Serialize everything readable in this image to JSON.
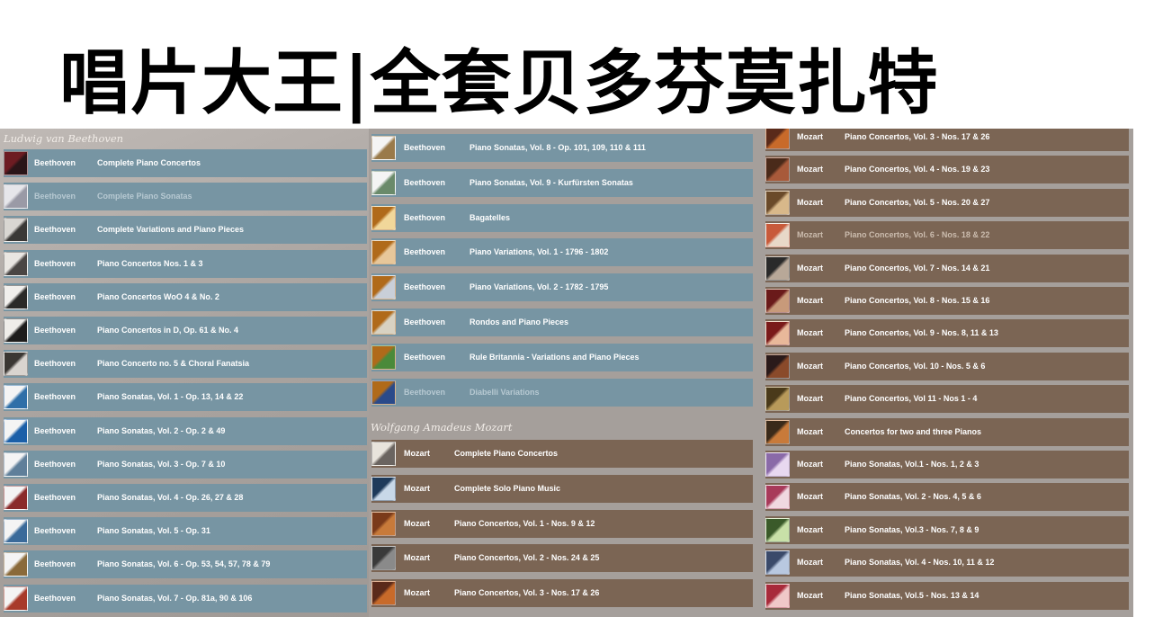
{
  "banner": {
    "title": "唱片大王|全套贝多芬莫扎特"
  },
  "columns": {
    "left": {
      "section_title": "Ludwig van Beethoven",
      "items": [
        {
          "composer": "Beethoven",
          "title": "Complete Piano Concertos",
          "thumb": [
            "#6d1c22",
            "#2a1518"
          ],
          "dim": false
        },
        {
          "composer": "Beethoven",
          "title": "Complete Piano Sonatas",
          "thumb": [
            "#e6e6ea",
            "#9a9aa6"
          ],
          "dim": true
        },
        {
          "composer": "Beethoven",
          "title": "Complete Variations and Piano Pieces",
          "thumb": [
            "#d9d6d2",
            "#3a3836"
          ],
          "dim": false
        },
        {
          "composer": "Beethoven",
          "title": "Piano Concertos Nos. 1 & 3",
          "thumb": [
            "#e9e6e2",
            "#4a4644"
          ],
          "dim": false
        },
        {
          "composer": "Beethoven",
          "title": "Piano Concertos WoO 4 & No. 2",
          "thumb": [
            "#f1efec",
            "#2b2a28"
          ],
          "dim": false
        },
        {
          "composer": "Beethoven",
          "title": "Piano Concertos in D, Op. 61 & No. 4",
          "thumb": [
            "#efede9",
            "#1e1d1c"
          ],
          "dim": false
        },
        {
          "composer": "Beethoven",
          "title": "Piano Concerto no. 5 & Choral Fanatsia",
          "thumb": [
            "#3b3733",
            "#d9d4cf"
          ],
          "dim": false
        },
        {
          "composer": "Beethoven",
          "title": "Piano Sonatas, Vol. 1 - Op. 13, 14 & 22",
          "thumb": [
            "#f4f4f4",
            "#2f6fa8"
          ],
          "dim": false
        },
        {
          "composer": "Beethoven",
          "title": "Piano Sonatas, Vol. 2 - Op. 2 & 49",
          "thumb": [
            "#f4f4f4",
            "#1b5fa8"
          ],
          "dim": false
        },
        {
          "composer": "Beethoven",
          "title": "Piano Sonatas, Vol. 3 - Op. 7 & 10",
          "thumb": [
            "#f4f4f4",
            "#5f7f9a"
          ],
          "dim": false
        },
        {
          "composer": "Beethoven",
          "title": "Piano Sonatas, Vol. 4 - Op. 26, 27 & 28",
          "thumb": [
            "#f4f4f4",
            "#8a2a2a"
          ],
          "dim": false
        },
        {
          "composer": "Beethoven",
          "title": "Piano Sonatas, Vol. 5 - Op. 31",
          "thumb": [
            "#f4f4f4",
            "#3a6a9a"
          ],
          "dim": false
        },
        {
          "composer": "Beethoven",
          "title": "Piano Sonatas, Vol. 6 - Op. 53, 54, 57, 78 & 79",
          "thumb": [
            "#f4f4f4",
            "#8a6a3a"
          ],
          "dim": false
        },
        {
          "composer": "Beethoven",
          "title": "Piano Sonatas, Vol. 7 - Op. 81a, 90 & 106",
          "thumb": [
            "#f4f4f4",
            "#a83a2a"
          ],
          "dim": false
        }
      ]
    },
    "middle": {
      "beethoven_items": [
        {
          "composer": "Beethoven",
          "title": "Piano Sonatas, Vol. 8 - Op. 101, 109, 110 & 111",
          "thumb": [
            "#f4f4f4",
            "#9a7a4a"
          ],
          "dim": false
        },
        {
          "composer": "Beethoven",
          "title": "Piano Sonatas, Vol. 9 - Kurfürsten Sonatas",
          "thumb": [
            "#f4f4f4",
            "#6a8a6a"
          ],
          "dim": false
        },
        {
          "composer": "Beethoven",
          "title": "Bagatelles",
          "thumb": [
            "#b06a1a",
            "#f1d79a"
          ],
          "dim": false
        },
        {
          "composer": "Beethoven",
          "title": "Piano Variations, Vol. 1 - 1796 - 1802",
          "thumb": [
            "#b06a1a",
            "#e7c79a"
          ],
          "dim": false
        },
        {
          "composer": "Beethoven",
          "title": "Piano Variations, Vol. 2 - 1782 - 1795",
          "thumb": [
            "#b06a1a",
            "#c9cfd8"
          ],
          "dim": false
        },
        {
          "composer": "Beethoven",
          "title": "Rondos and Piano Pieces",
          "thumb": [
            "#b06a1a",
            "#d8d2c2"
          ],
          "dim": false
        },
        {
          "composer": "Beethoven",
          "title": "Rule Britannia - Variations and Piano Pieces",
          "thumb": [
            "#b06a1a",
            "#4a8a3a"
          ],
          "dim": false
        },
        {
          "composer": "Beethoven",
          "title": "Diabelli Variations",
          "thumb": [
            "#b06a1a",
            "#2a4a8a"
          ],
          "dim": true
        }
      ],
      "section_title": "Wolfgang Amadeus Mozart",
      "mozart_items": [
        {
          "composer": "Mozart",
          "title": "Complete Piano Concertos",
          "thumb": [
            "#e8e4dc",
            "#6a6460"
          ],
          "dim": false
        },
        {
          "composer": "Mozart",
          "title": "Complete Solo Piano Music",
          "thumb": [
            "#1e3a5a",
            "#c8d8e8"
          ],
          "dim": false
        },
        {
          "composer": "Mozart",
          "title": "Piano Concertos, Vol. 1 - Nos. 9 & 12",
          "thumb": [
            "#7a3a1a",
            "#c87a3a"
          ],
          "dim": false
        },
        {
          "composer": "Mozart",
          "title": "Piano Concertos, Vol. 2 - Nos. 24 & 25",
          "thumb": [
            "#3a3a3a",
            "#8a8a8a"
          ],
          "dim": false
        },
        {
          "composer": "Mozart",
          "title": "Piano Concertos, Vol. 3 - Nos. 17 & 26",
          "thumb": [
            "#5a2a1a",
            "#c86a2a"
          ],
          "dim": false
        }
      ]
    },
    "right": {
      "items": [
        {
          "composer": "Mozart",
          "title": "Piano Concertos, Vol. 3 - Nos. 17 & 26",
          "thumb": [
            "#5a2a1a",
            "#c86a2a"
          ],
          "dim": false
        },
        {
          "composer": "Mozart",
          "title": "Piano Concertos, Vol. 4 - Nos. 19 & 23",
          "thumb": [
            "#4a2a1a",
            "#a85a3a"
          ],
          "dim": false
        },
        {
          "composer": "Mozart",
          "title": "Piano Concertos, Vol. 5 - Nos. 20 & 27",
          "thumb": [
            "#6a4a2a",
            "#d8b88a"
          ],
          "dim": false
        },
        {
          "composer": "Mozart",
          "title": "Piano Concertos, Vol. 6 - Nos. 18 & 22",
          "thumb": [
            "#c85a3a",
            "#e8d8c8"
          ],
          "dim": true
        },
        {
          "composer": "Mozart",
          "title": "Piano Concertos, Vol. 7 - Nos. 14 & 21",
          "thumb": [
            "#2a2a2a",
            "#b8a898"
          ],
          "dim": false
        },
        {
          "composer": "Mozart",
          "title": "Piano Concertos, Vol. 8 - Nos. 15 & 16",
          "thumb": [
            "#6a1a1a",
            "#c89a7a"
          ],
          "dim": false
        },
        {
          "composer": "Mozart",
          "title": "Piano Concertos, Vol. 9 - Nos. 8, 11 & 13",
          "thumb": [
            "#7a1a1a",
            "#e8b89a"
          ],
          "dim": false
        },
        {
          "composer": "Mozart",
          "title": "Piano Concertos, Vol. 10 - Nos. 5 & 6",
          "thumb": [
            "#2a1a1a",
            "#8a4a2a"
          ],
          "dim": false
        },
        {
          "composer": "Mozart",
          "title": "Piano Concertos, Vol 11 - Nos 1 - 4",
          "thumb": [
            "#4a3a1a",
            "#b89a5a"
          ],
          "dim": false
        },
        {
          "composer": "Mozart",
          "title": "Concertos for two and three Pianos",
          "thumb": [
            "#3a2a1a",
            "#c87a3a"
          ],
          "dim": false
        },
        {
          "composer": "Mozart",
          "title": "Piano Sonatas, Vol.1 - Nos. 1, 2 & 3",
          "thumb": [
            "#8a6aa8",
            "#e8d8f0"
          ],
          "dim": false
        },
        {
          "composer": "Mozart",
          "title": "Piano Sonatas, Vol. 2 - Nos. 4, 5 & 6",
          "thumb": [
            "#a83a5a",
            "#f0d8e0"
          ],
          "dim": false
        },
        {
          "composer": "Mozart",
          "title": "Piano Sonatas, Vol.3 - Nos. 7, 8 & 9",
          "thumb": [
            "#3a5a2a",
            "#c8e0a8"
          ],
          "dim": false
        },
        {
          "composer": "Mozart",
          "title": "Piano Sonatas, Vol. 4 - Nos. 10, 11 & 12",
          "thumb": [
            "#3a4a6a",
            "#b8c8e0"
          ],
          "dim": false
        },
        {
          "composer": "Mozart",
          "title": "Piano Sonatas, Vol.5 - Nos. 13 & 14",
          "thumb": [
            "#a82a3a",
            "#f0c8c8"
          ],
          "dim": false
        }
      ]
    }
  }
}
